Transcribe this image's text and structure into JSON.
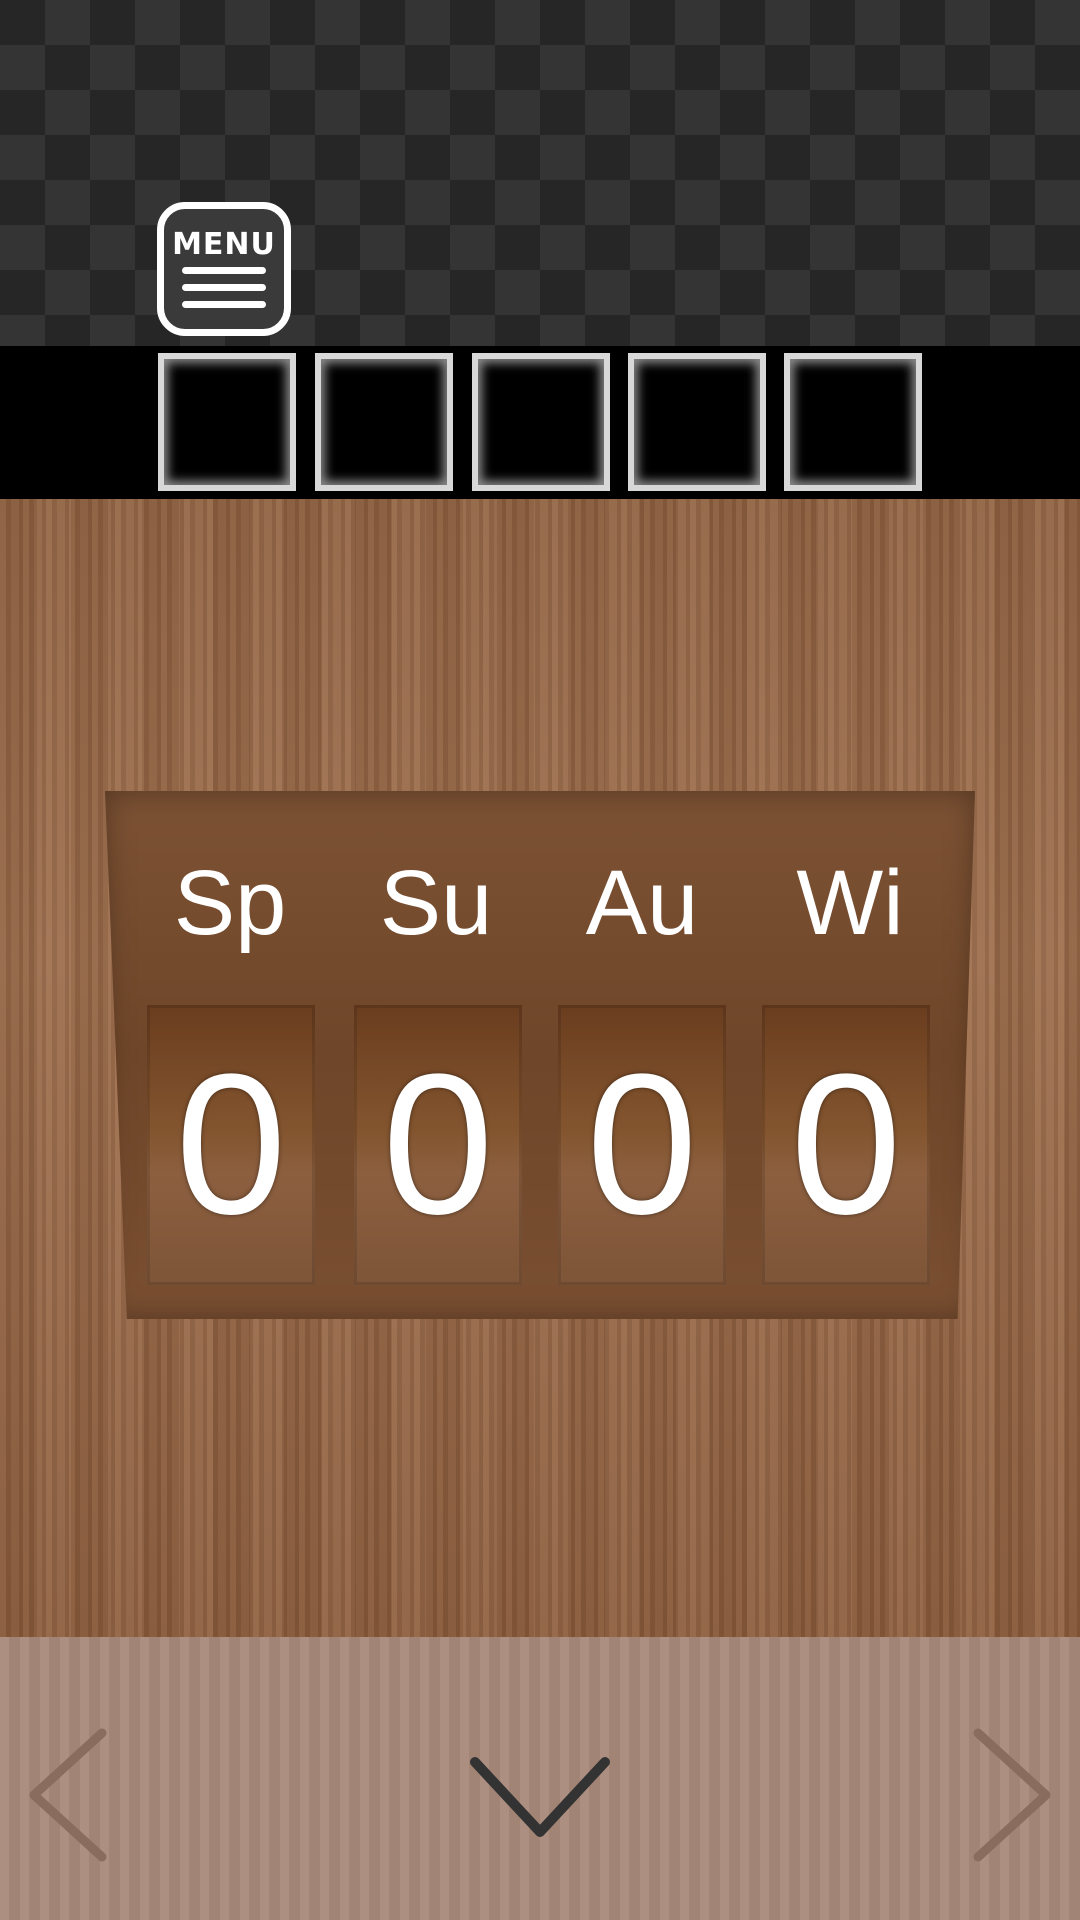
{
  "header": {
    "menu_label": "MENU"
  },
  "inventory": {
    "slots": [
      "",
      "",
      "",
      "",
      ""
    ]
  },
  "puzzle": {
    "labels": [
      "Sp",
      "Su",
      "Au",
      "Wi"
    ],
    "digits": [
      "0",
      "0",
      "0",
      "0"
    ]
  },
  "navigation": {
    "left": "chevron-left-icon",
    "down": "chevron-down-icon",
    "right": "chevron-right-icon"
  },
  "colors": {
    "wood": "#8f6141",
    "panel": "#6f4629",
    "nav_bar": "#a8897a",
    "inventory_bar": "#000000"
  }
}
